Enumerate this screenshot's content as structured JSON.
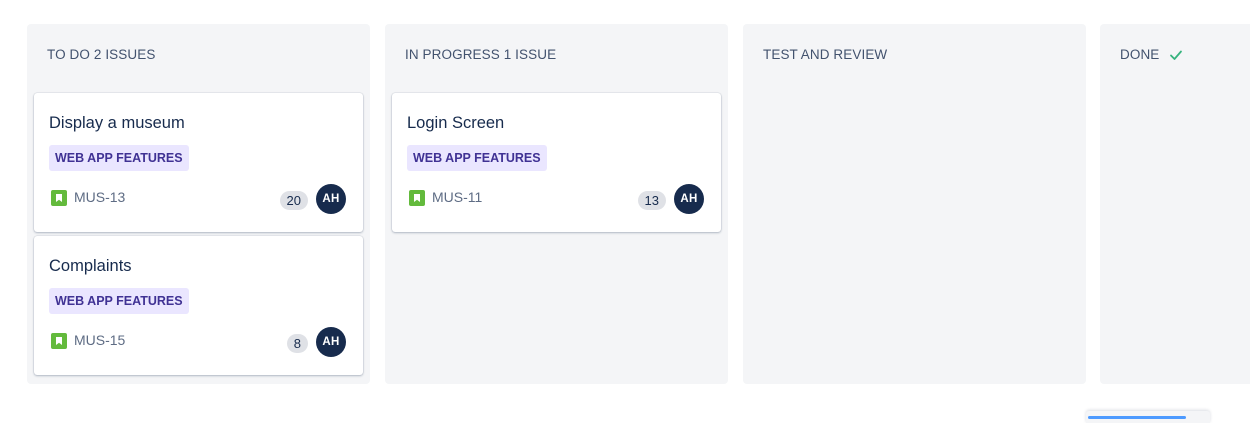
{
  "columns": [
    {
      "id": "todo",
      "header": "TO DO 2 ISSUES",
      "cards": [
        {
          "title": "Display a museum",
          "epic": "WEB APP FEATURES",
          "key": "MUS-13",
          "estimate": "20",
          "assignee_initials": "AH"
        },
        {
          "title": "Complaints",
          "epic": "WEB APP FEATURES",
          "key": "MUS-15",
          "estimate": "8",
          "assignee_initials": "AH"
        }
      ]
    },
    {
      "id": "in-progress",
      "header": "IN PROGRESS 1 ISSUE",
      "cards": [
        {
          "title": "Login Screen",
          "epic": "WEB APP FEATURES",
          "key": "MUS-11",
          "estimate": "13",
          "assignee_initials": "AH"
        }
      ]
    },
    {
      "id": "test-review",
      "header": "TEST AND REVIEW",
      "cards": []
    },
    {
      "id": "done",
      "header": "DONE",
      "header_icon": "check-icon",
      "cards": []
    }
  ],
  "colors": {
    "column_bg": "#f4f5f7",
    "epic_bg": "#eae6ff",
    "epic_text": "#403294",
    "story_icon": "#63ba3c",
    "avatar_bg": "#172b4d",
    "done_check": "#36b37e"
  }
}
